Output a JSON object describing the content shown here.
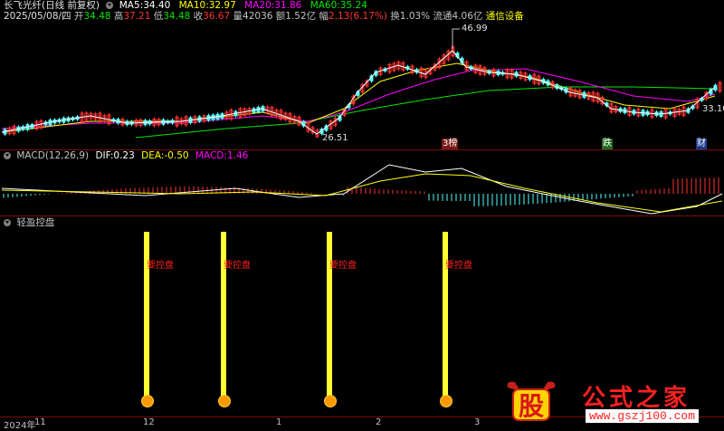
{
  "price_header": {
    "title": "长飞光纤(日线 前复权)",
    "ma5_label": "MA5:",
    "ma5": "34.40",
    "ma10_label": "MA10:",
    "ma10": "32.97",
    "ma20_label": "MA20:",
    "ma20": "31.86",
    "ma60_label": "MA60:",
    "ma60": "35.24"
  },
  "quote": {
    "date": "2025/05/08/四",
    "open_label": "开",
    "open": "34.48",
    "high_label": "高",
    "high": "37.21",
    "low_label": "低",
    "low": "34.48",
    "close_label": "收",
    "close": "36.67",
    "vol_label": "量",
    "vol": "42036",
    "amount_label": "额",
    "amount": "1.52亿",
    "change_label": "幅",
    "change": "2.13(6.17%)",
    "turnover_label": "换",
    "turnover": "1.03%",
    "float_label": "流通",
    "float": "4.06亿",
    "sector": "通信设备"
  },
  "price_chart": {
    "peak_label": "46.99",
    "low_label": "26.51",
    "right_label": "33.10",
    "event_tags": [
      "3榜",
      "跌",
      "财"
    ]
  },
  "macd_header": {
    "name": "MACD(12,26,9)",
    "dif_label": "DIF:",
    "dif": "0.23",
    "dea_label": "DEA:",
    "dea": "-0.50",
    "macd_label": "MACD:",
    "macd": "1.46"
  },
  "indicator": {
    "name": "轻盈控盘",
    "signal_label": "要控盘"
  },
  "x_axis": {
    "labels": [
      "2024年",
      "11",
      "12",
      "1",
      "2",
      "3"
    ]
  },
  "watermark": {
    "brand": "公式之家",
    "url": "www.gszj100.com",
    "stock_char": "股"
  },
  "colors": {
    "bg": "#000000",
    "up": "#ff3232",
    "down": "#54ffff",
    "ma5": "#ffffff",
    "ma10": "#ffff00",
    "ma20": "#ff00ff",
    "ma60": "#00e600",
    "signal_bar": "#ffff33",
    "separator": "#7a0d0d"
  }
}
